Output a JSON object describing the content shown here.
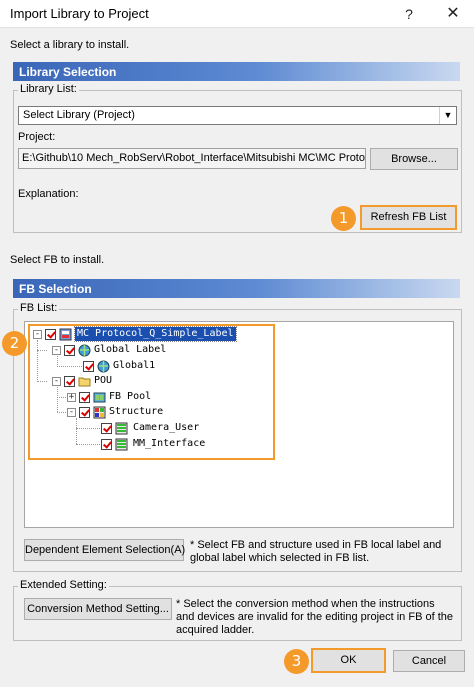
{
  "window": {
    "title": "Import Library to Project",
    "help": "?",
    "close": "✕"
  },
  "prompt_library": "Select a library to install.",
  "library_section": {
    "header": "Library Selection",
    "group_label": "Library List:",
    "library_combo": "Select Library (Project)",
    "project_label": "Project:",
    "project_path": "E:\\Github\\10 Mech_RobServ\\Robot_Interface\\Mitsubishi MC\\MC Protoco",
    "browse_button": "Browse...",
    "explanation_label": "Explanation:",
    "refresh_button": "Refresh FB List"
  },
  "prompt_fb": "Select FB to install.",
  "fb_section": {
    "header": "FB Selection",
    "group_label": "FB List:",
    "tree": [
      {
        "label": "MC Protocol_Q_Simple_Label",
        "icon": "project-icon",
        "level": 0,
        "expander": "-"
      },
      {
        "label": "Global Label",
        "icon": "global-label-icon",
        "level": 1,
        "expander": "-"
      },
      {
        "label": "Global1",
        "icon": "global-label-icon",
        "level": 2,
        "expander": ""
      },
      {
        "label": "POU",
        "icon": "folder-icon",
        "level": 1,
        "expander": "-"
      },
      {
        "label": "FB Pool",
        "icon": "fb-pool-icon",
        "level": 2,
        "expander": "+"
      },
      {
        "label": "Structure",
        "icon": "structure-icon",
        "level": 2,
        "expander": "-"
      },
      {
        "label": "Camera_User",
        "icon": "structure-icon",
        "level": 3,
        "expander": ""
      },
      {
        "label": "MM_Interface",
        "icon": "structure-icon",
        "level": 3,
        "expander": ""
      }
    ],
    "dependent_button": "Dependent Element Selection(A)",
    "dependent_note": "* Select FB and structure used in FB local label and global label which selected in FB list."
  },
  "extended": {
    "group_label": "Extended Setting:",
    "conversion_button": "Conversion Method Setting...",
    "conversion_note": "* Select the conversion method when the instructions and devices are invalid for the editing project in FB of the acquired ladder."
  },
  "footer": {
    "ok_button": "OK",
    "cancel_button": "Cancel"
  },
  "badges": [
    "1",
    "2",
    "3"
  ],
  "colors": {
    "accent_orange": "#f39a2a",
    "section_blue": "#3a66b8",
    "selection_blue": "#1a4fb0",
    "check_red": "#dd0000"
  }
}
